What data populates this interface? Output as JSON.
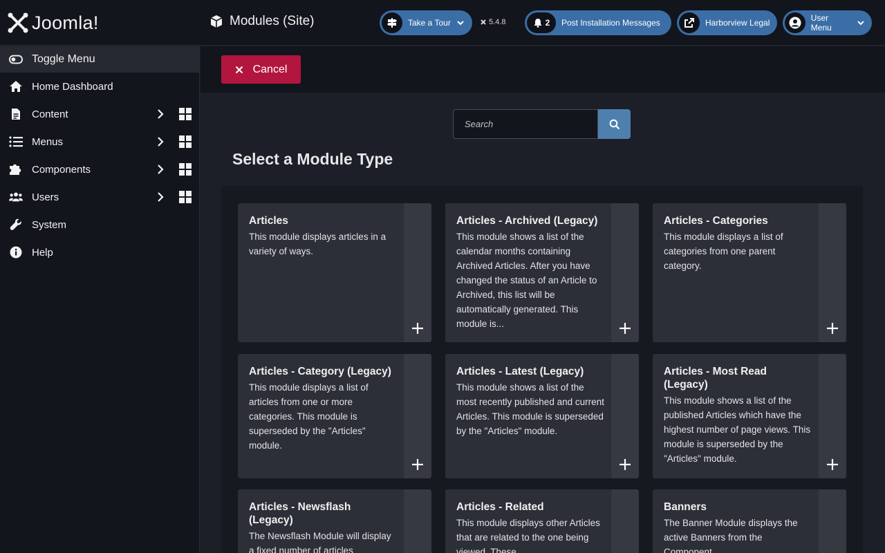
{
  "header": {
    "brand": "Joomla!",
    "page_title": "Modules (Site)",
    "tour_label": "Take a Tour",
    "version": "5.4.8",
    "notif_count": "2",
    "post_install_label": "Post Installation Messages",
    "site_label": "Harborview Legal",
    "user_menu_label": "User Menu"
  },
  "sidebar": {
    "items": [
      {
        "label": "Toggle Menu"
      },
      {
        "label": "Home Dashboard"
      },
      {
        "label": "Content"
      },
      {
        "label": "Menus"
      },
      {
        "label": "Components"
      },
      {
        "label": "Users"
      },
      {
        "label": "System"
      },
      {
        "label": "Help"
      }
    ]
  },
  "toolbar": {
    "cancel_label": "Cancel"
  },
  "search": {
    "placeholder": "Search"
  },
  "main": {
    "title": "Select a Module Type",
    "cards": [
      {
        "title": "Articles",
        "desc": "This module displays articles in a variety of ways."
      },
      {
        "title": "Articles - Archived (Legacy)",
        "desc": "This module shows a list of the calendar months containing Archived Articles. After you have changed the status of an Article to Archived, this list will be automatically generated. This module is..."
      },
      {
        "title": "Articles - Categories",
        "desc": "This module displays a list of categories from one parent category."
      },
      {
        "title": "Articles - Category (Legacy)",
        "desc": "This module displays a list of articles from one or more categories. This module is superseded by the \"Articles\" module."
      },
      {
        "title": "Articles - Latest (Legacy)",
        "desc": "This module shows a list of the most recently published and current Articles. This module is superseded by the \"Articles\" module."
      },
      {
        "title": "Articles - Most Read (Legacy)",
        "desc": "This module shows a list of the published Articles which have the highest number of page views. This module is superseded by the \"Articles\" module."
      },
      {
        "title": "Articles - Newsflash (Legacy)",
        "desc": "The Newsflash Module will display a fixed number of articles"
      },
      {
        "title": "Articles - Related",
        "desc": "This module displays other Articles that are related to the one being viewed. These"
      },
      {
        "title": "Banners",
        "desc": "The Banner Module displays the active Banners from the Component"
      }
    ]
  },
  "colors": {
    "header_bg": "#12151c",
    "pill": "#3b6ea6",
    "cancel": "#b2163f",
    "search_button": "#4f80ad",
    "card": "#2c2f37"
  },
  "icons": {
    "logo": "joomla-logo-icon",
    "title": "cube-icon",
    "tour": "signpost-icon",
    "notif": "bell-icon",
    "site": "external-link-icon",
    "user": "user-circle-icon"
  }
}
